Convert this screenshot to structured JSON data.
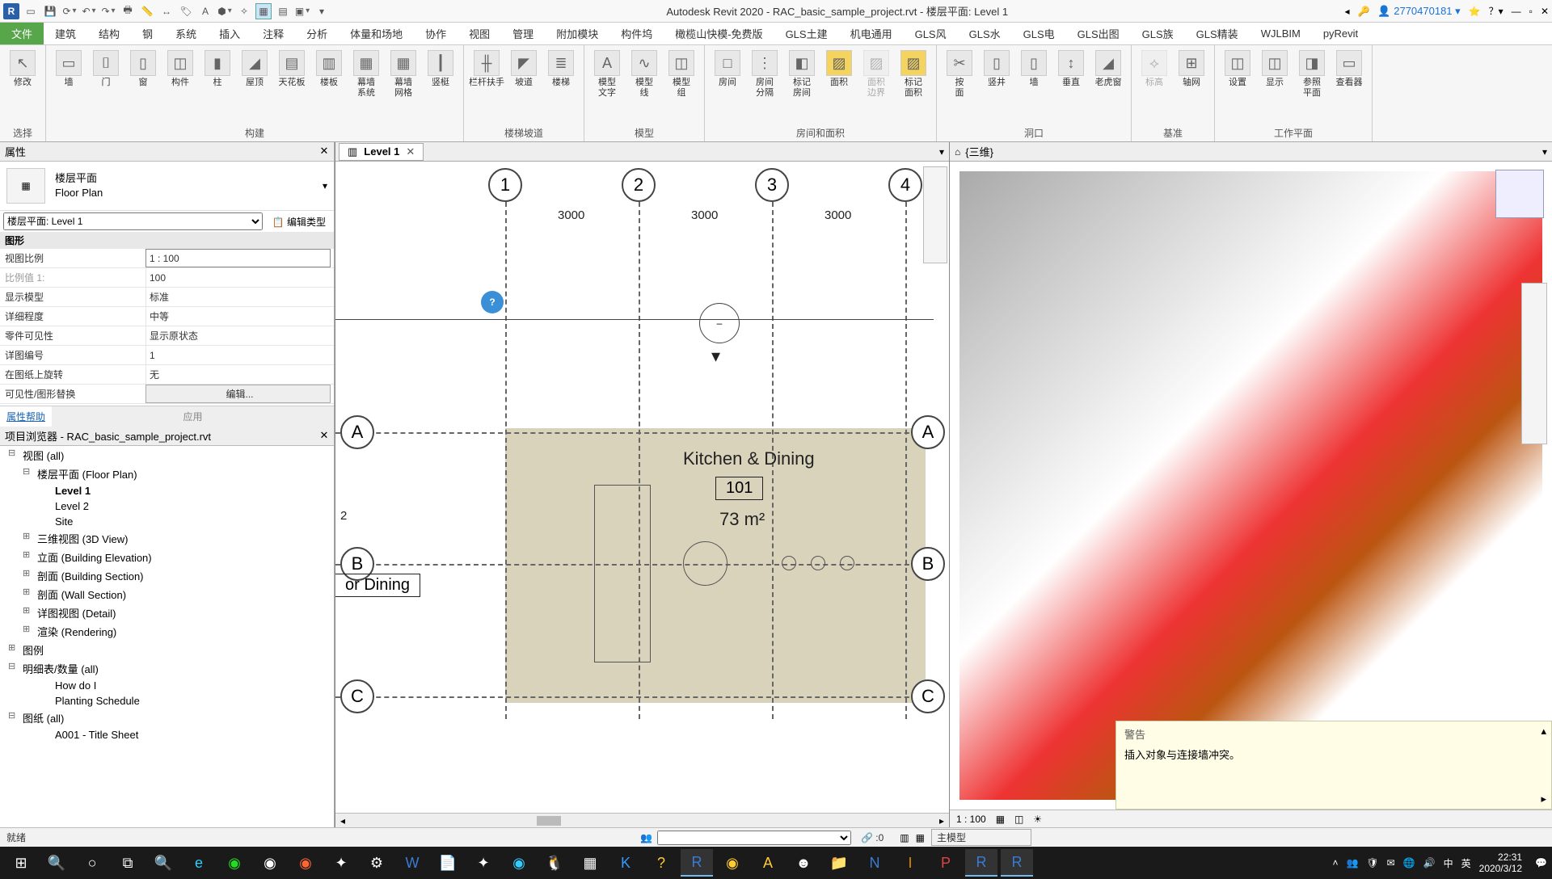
{
  "title": "Autodesk Revit 2020 - RAC_basic_sample_project.rvt - 楼层平面: Level 1",
  "user": "2770470181",
  "ribbonTabs": [
    "文件",
    "建筑",
    "结构",
    "钢",
    "系统",
    "插入",
    "注释",
    "分析",
    "体量和场地",
    "协作",
    "视图",
    "管理",
    "附加模块",
    "构件坞",
    "橄榄山快模-免费版",
    "GLS土建",
    "机电通用",
    "GLS风",
    "GLS水",
    "GLS电",
    "GLS出图",
    "GLS族",
    "GLS精装",
    "WJLBIM",
    "pyRevit"
  ],
  "activeTab": 0,
  "ribbonGroups": [
    {
      "label": "选择",
      "items": [
        {
          "l": "修改",
          "i": "↖"
        }
      ]
    },
    {
      "label": "构建",
      "items": [
        {
          "l": "墙",
          "i": "▭"
        },
        {
          "l": "门",
          "i": "⌷"
        },
        {
          "l": "窗",
          "i": "▯"
        },
        {
          "l": "构件",
          "i": "◫"
        },
        {
          "l": "柱",
          "i": "▮"
        },
        {
          "l": "屋顶",
          "i": "◢"
        },
        {
          "l": "天花板",
          "i": "▤"
        },
        {
          "l": "楼板",
          "i": "▥"
        },
        {
          "l": "幕墙\n系统",
          "i": "▦"
        },
        {
          "l": "幕墙\n网格",
          "i": "▦"
        },
        {
          "l": "竖梃",
          "i": "┃"
        }
      ]
    },
    {
      "label": "楼梯坡道",
      "items": [
        {
          "l": "栏杆扶手",
          "i": "╫"
        },
        {
          "l": "坡道",
          "i": "◤"
        },
        {
          "l": "楼梯",
          "i": "≣"
        }
      ]
    },
    {
      "label": "模型",
      "items": [
        {
          "l": "模型\n文字",
          "i": "A"
        },
        {
          "l": "模型\n线",
          "i": "∿"
        },
        {
          "l": "模型\n组",
          "i": "◫"
        }
      ]
    },
    {
      "label": "房间和面积",
      "items": [
        {
          "l": "房间",
          "i": "□"
        },
        {
          "l": "房间\n分隔",
          "i": "⋮"
        },
        {
          "l": "标记\n房间",
          "i": "◧"
        },
        {
          "l": "面积",
          "i": "▨",
          "y": true
        },
        {
          "l": "面积\n边界",
          "i": "▨",
          "d": true
        },
        {
          "l": "标记\n面积",
          "i": "▨",
          "y": true
        }
      ]
    },
    {
      "label": "洞口",
      "items": [
        {
          "l": "按\n面",
          "i": "✂"
        },
        {
          "l": "竖井",
          "i": "▯"
        },
        {
          "l": "墙",
          "i": "▯"
        },
        {
          "l": "垂直",
          "i": "↕"
        },
        {
          "l": "老虎窗",
          "i": "◢"
        }
      ]
    },
    {
      "label": "基准",
      "items": [
        {
          "l": "标高",
          "i": "⟡",
          "d": true
        },
        {
          "l": "轴网",
          "i": "⊞"
        }
      ]
    },
    {
      "label": "工作平面",
      "items": [
        {
          "l": "设置",
          "i": "◫"
        },
        {
          "l": "显示",
          "i": "◫"
        },
        {
          "l": "参照\n平面",
          "i": "◨"
        },
        {
          "l": "查看器",
          "i": "▭"
        }
      ]
    }
  ],
  "props": {
    "header": "属性",
    "typeName1": "楼层平面",
    "typeName2": "Floor Plan",
    "instance": "楼层平面: Level 1",
    "editType": "编辑类型",
    "section": "图形",
    "rows": [
      {
        "k": "视图比例",
        "v": "1 : 100",
        "box": true
      },
      {
        "k": "比例值 1:",
        "v": "100",
        "dim": true
      },
      {
        "k": "显示模型",
        "v": "标准"
      },
      {
        "k": "详细程度",
        "v": "中等"
      },
      {
        "k": "零件可见性",
        "v": "显示原状态"
      },
      {
        "k": "详图编号",
        "v": "1"
      },
      {
        "k": "在图纸上旋转",
        "v": "无"
      },
      {
        "k": "可见性/图形替换",
        "v": "编辑...",
        "btn": true
      }
    ],
    "help": "属性帮助",
    "apply": "应用"
  },
  "browser": {
    "header": "项目浏览器 - RAC_basic_sample_project.rvt",
    "items": [
      {
        "t": "视图 (all)",
        "lv": 0,
        "m": true
      },
      {
        "t": "楼层平面 (Floor Plan)",
        "lv": 1,
        "m": true
      },
      {
        "t": "Level 1",
        "lv": 2,
        "b": true
      },
      {
        "t": "Level 2",
        "lv": 2
      },
      {
        "t": "Site",
        "lv": 2
      },
      {
        "t": "三维视图 (3D View)",
        "lv": 1
      },
      {
        "t": "立面 (Building Elevation)",
        "lv": 1
      },
      {
        "t": "剖面 (Building Section)",
        "lv": 1
      },
      {
        "t": "剖面 (Wall Section)",
        "lv": 1
      },
      {
        "t": "详图视图 (Detail)",
        "lv": 1
      },
      {
        "t": "渲染 (Rendering)",
        "lv": 1
      },
      {
        "t": "图例",
        "lv": 0
      },
      {
        "t": "明细表/数量 (all)",
        "lv": 0,
        "m": true
      },
      {
        "t": "How do I",
        "lv": 2
      },
      {
        "t": "Planting Schedule",
        "lv": 2
      },
      {
        "t": "图纸 (all)",
        "lv": 0,
        "m": true
      },
      {
        "t": "A001 - Title Sheet",
        "lv": 2
      }
    ]
  },
  "view2d": {
    "tab": "Level 1",
    "grids": [
      "1",
      "2",
      "3",
      "4"
    ],
    "dims": [
      "3000",
      "3000",
      "3000"
    ],
    "gridLetters": [
      "A",
      "B",
      "C"
    ],
    "room": "Kitchen & Dining",
    "roomNum": "101",
    "roomArea": "73 m²",
    "leftRoom": "or Dining",
    "leftNum": "2"
  },
  "view3d": {
    "tab": "{三维}",
    "scale": "1 : 100",
    "warnTitle": "警告",
    "warnMsg": "插入对象与连接墙冲突。"
  },
  "status": {
    "ready": "就绪",
    "zero": ":0",
    "model": "主模型"
  },
  "taskbar": {
    "time": "22:31",
    "date": "2020/3/12"
  },
  "chart_data": null
}
